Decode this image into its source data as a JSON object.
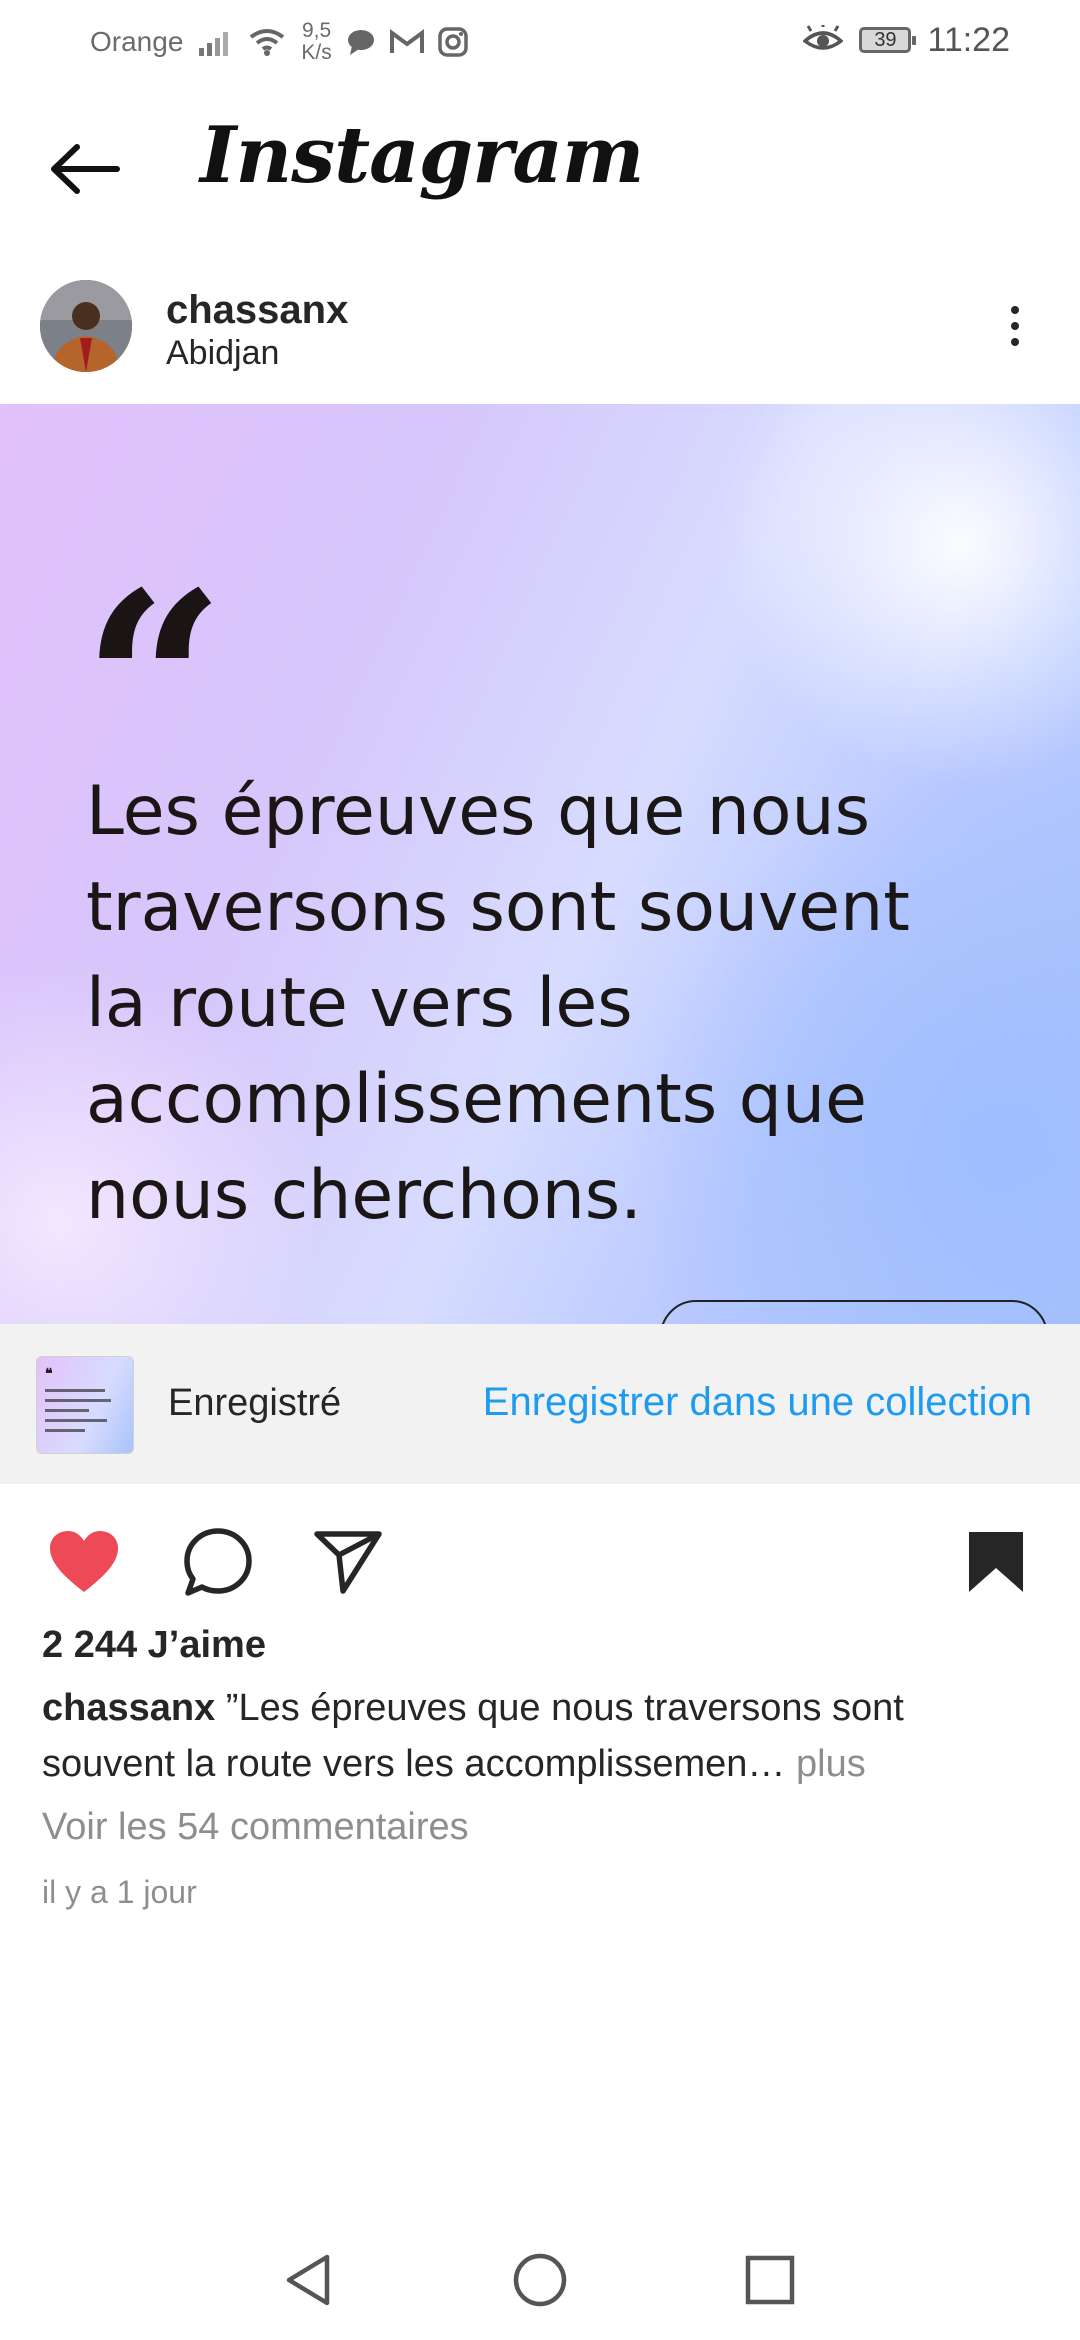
{
  "status_bar": {
    "carrier": "Orange",
    "net_speed_value": "9,5",
    "net_speed_unit": "K/s",
    "battery": "39",
    "time": "11:22",
    "icons": [
      "signal-icon",
      "wifi-icon",
      "chat-icon",
      "gmail-icon",
      "instagram-icon",
      "eye-icon",
      "battery-icon"
    ]
  },
  "header": {
    "title": "Instagram",
    "back_icon": "arrow-left-icon"
  },
  "post": {
    "username": "chassanx",
    "location": "Abidjan",
    "quote_mark": "“",
    "quote_lines": [
      "Les épreuves que nous",
      "traversons sont souvent",
      "la route vers les",
      "accomplissements que",
      "nous cherchons."
    ]
  },
  "saved_banner": {
    "label": "Enregistré",
    "action": "Enregistrer dans une collection"
  },
  "actions": {
    "liked": true,
    "saved": true,
    "like_color": "#ed4956"
  },
  "stats": {
    "likes_text": "2 244 J’aime",
    "caption_user": "chassanx",
    "caption_text": " ”Les épreuves que nous traversons sont souvent la route vers les accomplissemen…",
    "caption_more": " plus",
    "comments_link": "Voir les 54 commentaires",
    "time_ago": "il y a 1 jour"
  },
  "colors": {
    "link_blue": "#1d9bf0",
    "saved_bg": "#f2f2f2",
    "text_dark": "#262626",
    "text_muted": "#8e8e8e"
  }
}
